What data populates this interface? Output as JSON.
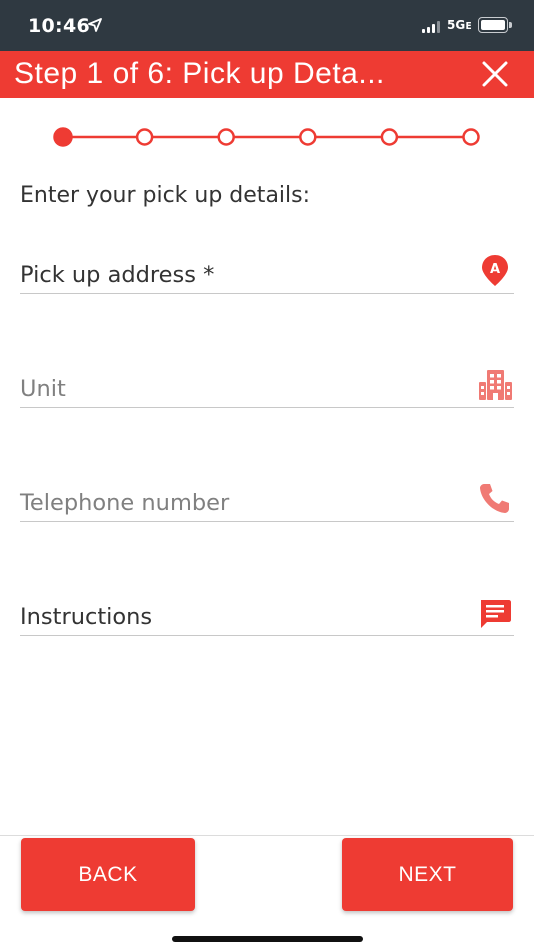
{
  "status_bar": {
    "time": "10:46",
    "network": "5Gᴇ"
  },
  "header": {
    "title": "Step 1 of 6: Pick up Deta..."
  },
  "stepper": {
    "total_steps": 6,
    "current_step": 1
  },
  "prompt": "Enter your pick up details:",
  "fields": [
    {
      "label": "Pick up address *",
      "icon": "map-pin-icon"
    },
    {
      "label": "Unit",
      "icon": "building-icon"
    },
    {
      "label": "Telephone number",
      "icon": "phone-icon"
    },
    {
      "label": "Instructions",
      "icon": "message-icon"
    }
  ],
  "icons": {
    "map_pin_letter": "A"
  },
  "buttons": {
    "back": "BACK",
    "next": "NEXT"
  },
  "colors": {
    "accent": "#ee3b33",
    "status_bar": "#2f3941",
    "icon_light": "#f07a74"
  }
}
